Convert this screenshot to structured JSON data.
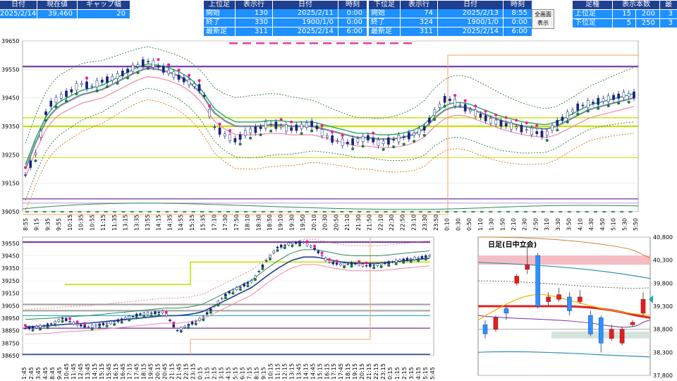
{
  "header": {
    "left_labels": [
      "日付",
      "現在値",
      "ギャップ幅"
    ],
    "left_values": [
      "2025/2/14",
      "39,460",
      "20"
    ],
    "upper_labels": [
      "上位足",
      "表示行",
      "日付",
      "時刻"
    ],
    "upper_rows": [
      [
        "開始",
        "130",
        "2025/2/11",
        "0:00"
      ],
      [
        "終了",
        "330",
        "1900/1/0",
        "0:00"
      ],
      [
        "最新足",
        "311",
        "2025/2/14",
        "6:00"
      ]
    ],
    "lower_labels": [
      "下位足",
      "表示行",
      "日付",
      "時刻"
    ],
    "lower_rows": [
      [
        "開始",
        "74",
        "2025/2/13",
        "8:55"
      ],
      [
        "終了",
        "324",
        "1900/1/0",
        "0:00"
      ],
      [
        "最新足",
        "311",
        "2025/2/14",
        "6:00"
      ]
    ],
    "fullscreen_button": [
      "全画面",
      "表示"
    ],
    "right_labels": [
      "足種",
      "表示本数",
      "最"
    ],
    "right_rows": [
      [
        "上位足",
        "15",
        "200",
        "3"
      ],
      [
        "下位足",
        "5",
        "250",
        "3"
      ]
    ]
  },
  "chart_data": [
    {
      "type": "line",
      "yticks": [
        "39650",
        "39550",
        "39450",
        "39350",
        "39250",
        "39150",
        "39050"
      ],
      "ylim": [
        39050,
        39650
      ],
      "xticks": [
        "8:55",
        "9:15",
        "9:35",
        "9:55",
        "10:15",
        "10:35",
        "10:55",
        "11:15",
        "11:35",
        "13:15",
        "13:35",
        "13:55",
        "14:15",
        "14:35",
        "14:55",
        "15:15",
        "15:35",
        "17:10",
        "17:30",
        "17:50",
        "18:10",
        "18:30",
        "18:50",
        "19:10",
        "19:30",
        "19:50",
        "20:10",
        "20:30",
        "20:50",
        "21:10",
        "21:30",
        "21:50",
        "22:10",
        "22:30",
        "22:50",
        "23:10",
        "23:30",
        "23:50",
        "0:10",
        "0:30",
        "0:50",
        "1:10",
        "1:30",
        "1:50",
        "2:10",
        "2:30",
        "2:50",
        "3:10",
        "3:30",
        "3:50",
        "4:10",
        "4:30",
        "4:50",
        "5:10",
        "5:30",
        "5:50"
      ],
      "series": [
        {
          "values": [
            39180,
            39260,
            39420,
            39450,
            39470,
            39500,
            39490,
            39510,
            39520,
            39540,
            39560,
            39580,
            39560,
            39540,
            39520,
            39500,
            39480,
            39350,
            39320,
            39300,
            39330,
            39340,
            39360,
            39350,
            39340,
            39350,
            39360,
            39320,
            39300,
            39290,
            39300,
            39310,
            39290,
            39300,
            39310,
            39320,
            39340,
            39400,
            39450,
            39430,
            39410,
            39390,
            39370,
            39360,
            39350,
            39340,
            39330,
            39320,
            39360,
            39390,
            39420,
            39430,
            39440,
            39450,
            39460,
            39460
          ]
        },
        {
          "values": [
            39200,
            39300,
            39380,
            39420,
            39440,
            39460,
            39470,
            39480,
            39500,
            39520,
            39540,
            39555,
            39550,
            39540,
            39525,
            39500,
            39460,
            39400,
            39370,
            39350,
            39350,
            39350,
            39355,
            39355,
            39350,
            39350,
            39350,
            39340,
            39330,
            39320,
            39310,
            39310,
            39305,
            39305,
            39310,
            39320,
            39340,
            39380,
            39410,
            39420,
            39415,
            39400,
            39385,
            39370,
            39360,
            39350,
            39345,
            39340,
            39350,
            39370,
            39390,
            39410,
            39420,
            39430,
            39440,
            39450
          ]
        }
      ]
    },
    {
      "type": "line",
      "yticks": [
        "39550",
        "39450",
        "39350",
        "39250",
        "39150",
        "39050",
        "38950",
        "38850",
        "38750",
        "38650"
      ],
      "ylim": [
        38650,
        39600
      ],
      "xticks": [
        "1:45",
        "2:45",
        "3:45",
        "4:45",
        "8:45",
        "9:45",
        "10:45",
        "11:45",
        "12:45",
        "13:45",
        "14:15",
        "15:15",
        "15:45",
        "16:15",
        "16:45",
        "17:15",
        "17:45",
        "18:15",
        "19:45",
        "20:15",
        "20:45",
        "21:15",
        "21:45",
        "22:15",
        "23:15",
        "0:15",
        "1:15",
        "2:15",
        "3:15",
        "4:15",
        "5:15",
        "6:15",
        "7:15",
        "8:15",
        "9:15",
        "10:15",
        "11:15",
        "12:15",
        "13:15",
        "13:45",
        "14:15",
        "14:45",
        "15:15",
        "16:15",
        "17:15",
        "17:45",
        "18:15",
        "19:15",
        "20:15",
        "21:15",
        "22:15",
        "23:15",
        "0:15",
        "1:15",
        "2:15",
        "3:15",
        "4:15",
        "5:15",
        "5:45"
      ],
      "series": [
        {
          "values": [
            38870,
            38880,
            38900,
            38950,
            38900,
            38880,
            38900,
            38920,
            38950,
            38980,
            38990,
            39000,
            38850,
            38900,
            38950,
            39050,
            39150,
            39200,
            39250,
            39400,
            39520,
            39550,
            39560,
            39500,
            39400,
            39380,
            39390,
            39370,
            39380,
            39400,
            39420,
            39430,
            39450
          ]
        },
        {
          "values": [
            38880,
            38885,
            38890,
            38900,
            38905,
            38910,
            38920,
            38930,
            38940,
            38950,
            38960,
            38970,
            38970,
            38980,
            39000,
            39050,
            39100,
            39150,
            39200,
            39280,
            39350,
            39410,
            39440,
            39440,
            39420,
            39400,
            39390,
            39390,
            39390,
            39400,
            39410,
            39420,
            39430
          ]
        }
      ]
    },
    {
      "type": "bar",
      "title": "日足(日中立会)",
      "yticks": [
        "40,800",
        "40,300",
        "39,800",
        "39,300",
        "38,800",
        "38,300",
        "37,800"
      ],
      "ylim": [
        37800,
        40800
      ],
      "candles": [
        {
          "o": 38900,
          "c": 38700,
          "h": 39000,
          "l": 38600
        },
        {
          "o": 38800,
          "c": 39050,
          "h": 39100,
          "l": 38750
        },
        {
          "o": 39250,
          "c": 39150,
          "h": 39300,
          "l": 39000
        },
        {
          "o": 39800,
          "c": 39950,
          "h": 40000,
          "l": 39750
        },
        {
          "o": 40100,
          "c": 40200,
          "h": 40600,
          "l": 40000
        },
        {
          "o": 40400,
          "c": 39300,
          "h": 40450,
          "l": 39250
        },
        {
          "o": 39400,
          "c": 39500,
          "h": 39600,
          "l": 39300
        },
        {
          "o": 39450,
          "c": 39550,
          "h": 39700,
          "l": 39400
        },
        {
          "o": 39500,
          "c": 39200,
          "h": 39600,
          "l": 39100
        },
        {
          "o": 39400,
          "c": 39500,
          "h": 39650,
          "l": 39350
        },
        {
          "o": 39100,
          "c": 38700,
          "h": 39200,
          "l": 38650
        },
        {
          "o": 39050,
          "c": 38500,
          "h": 39100,
          "l": 38300
        },
        {
          "o": 38600,
          "c": 38800,
          "h": 38900,
          "l": 38550
        },
        {
          "o": 38500,
          "c": 38800,
          "h": 38850,
          "l": 38450
        },
        {
          "o": 38900,
          "c": 38950,
          "h": 39000,
          "l": 38850
        },
        {
          "o": 39150,
          "c": 39450,
          "h": 39600,
          "l": 39100
        }
      ]
    }
  ],
  "colors": {
    "purple": "#7030a0",
    "lime": "#c6e000",
    "orange": "#f4a460",
    "green": "#2e8b57",
    "pink": "#ff1493",
    "gray": "#8090a0",
    "navy": "#1f3f8f",
    "blue": "#1e90ff"
  }
}
